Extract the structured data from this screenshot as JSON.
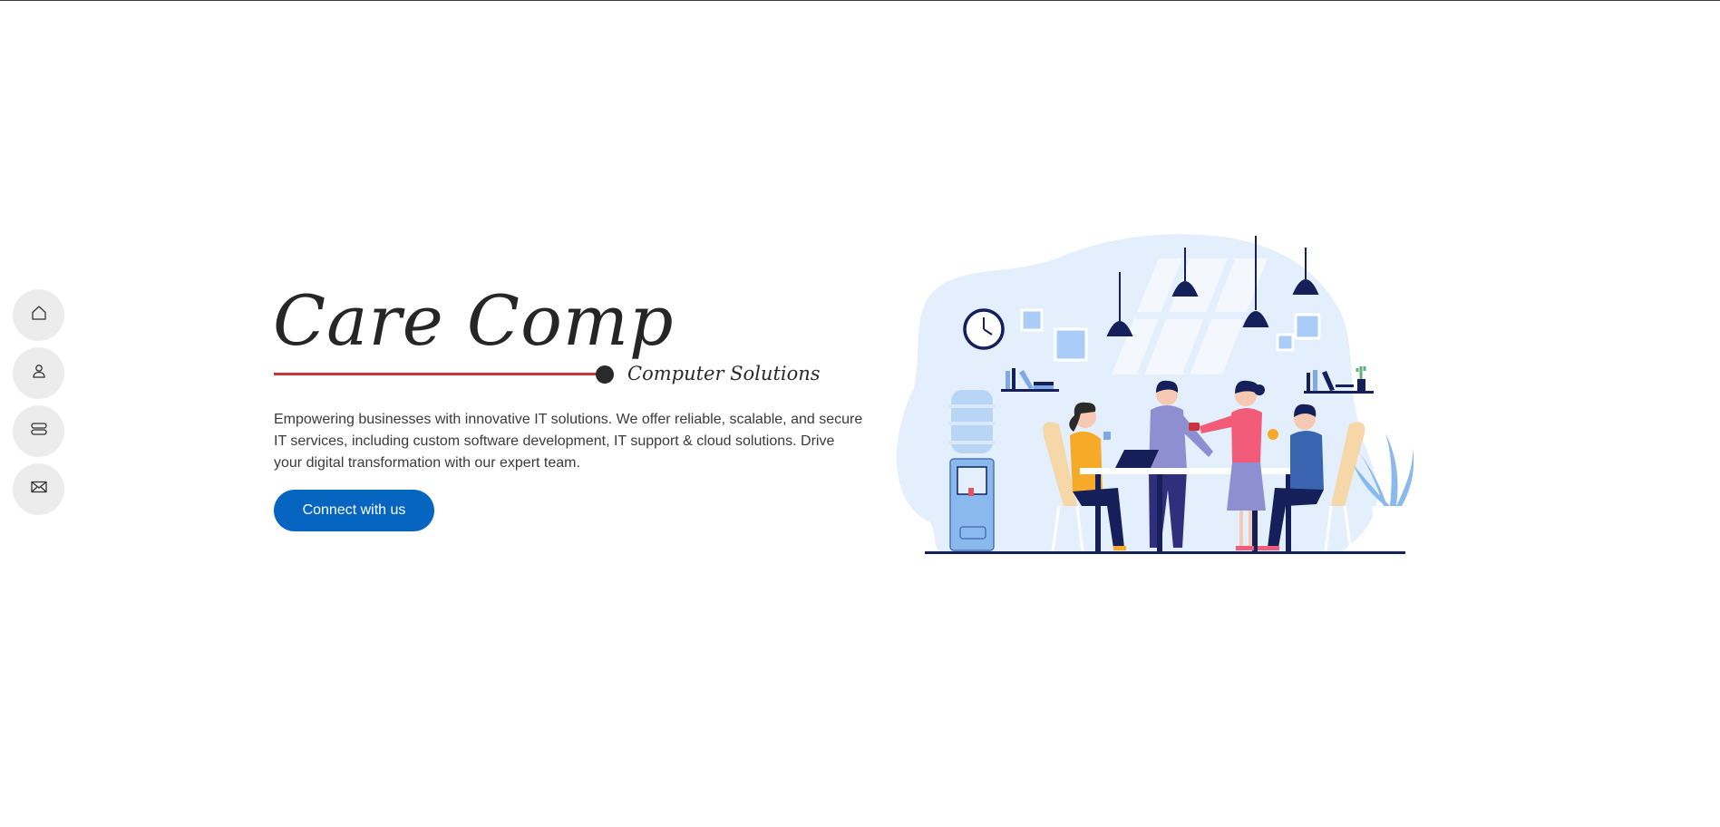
{
  "nav": {
    "items": [
      {
        "name": "home",
        "icon": "home-icon"
      },
      {
        "name": "about",
        "icon": "user-icon"
      },
      {
        "name": "services",
        "icon": "server-icon"
      },
      {
        "name": "contact",
        "icon": "mail-icon"
      }
    ]
  },
  "hero": {
    "title": "Care Comp",
    "subtitle": "Computer Solutions",
    "description": "Empowering businesses with innovative IT solutions. We offer reliable, scalable, and secure IT services, including custom software development, IT support & cloud solutions. Drive your digital transformation with our expert team.",
    "cta_label": "Connect with us"
  },
  "colors": {
    "accent_red": "#c9343d",
    "primary_blue": "#0565c1",
    "illustration_bg": "#e3effc",
    "navy": "#15205a"
  }
}
